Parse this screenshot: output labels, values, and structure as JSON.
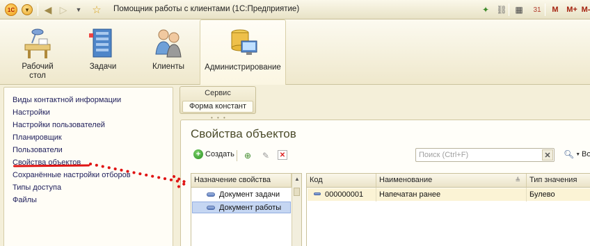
{
  "window": {
    "title": "Помощник работы с клиентами (1С:Предприятие)",
    "logo_text": "1С",
    "m_label": "M",
    "m_plus_label": "M+",
    "m_minus_label": "M-"
  },
  "sections": [
    {
      "label": "Рабочий стол",
      "icon": "desktop-icon"
    },
    {
      "label": "Задачи",
      "icon": "tasks-icon"
    },
    {
      "label": "Клиенты",
      "icon": "clients-icon"
    },
    {
      "label": "Администрирование",
      "icon": "administration-icon"
    }
  ],
  "nav": {
    "items": [
      {
        "label": "Виды контактной информации"
      },
      {
        "label": "Настройки"
      },
      {
        "label": "Настройки пользователей"
      },
      {
        "label": "Планировщик"
      },
      {
        "label": "Пользователи"
      },
      {
        "label": "Свойства объектов"
      },
      {
        "label": "Сохранённые настройки отборов"
      },
      {
        "label": "Типы доступа"
      },
      {
        "label": "Файлы"
      }
    ]
  },
  "form_tabs": {
    "header": "Сервис",
    "items": [
      {
        "label": "Форма констант"
      }
    ]
  },
  "form": {
    "title": "Свойства объектов",
    "toolbar": {
      "create_label": "Создать",
      "more_label": "Во"
    },
    "search": {
      "placeholder": "Поиск (Ctrl+F)"
    },
    "left_table": {
      "header": "Назначение свойства",
      "rows": [
        {
          "label": "Документ задачи",
          "selected": false
        },
        {
          "label": "Документ работы",
          "selected": true
        }
      ]
    },
    "right_table": {
      "columns": [
        "Код",
        "Наименование",
        "Тип значения"
      ],
      "rows": [
        {
          "code": "000000001",
          "name": "Напечатан ранее",
          "type": "Булево"
        }
      ]
    }
  },
  "colors": {
    "accent": "#e01414",
    "selection": "#c5d6f2",
    "background": "#f4efd9"
  }
}
